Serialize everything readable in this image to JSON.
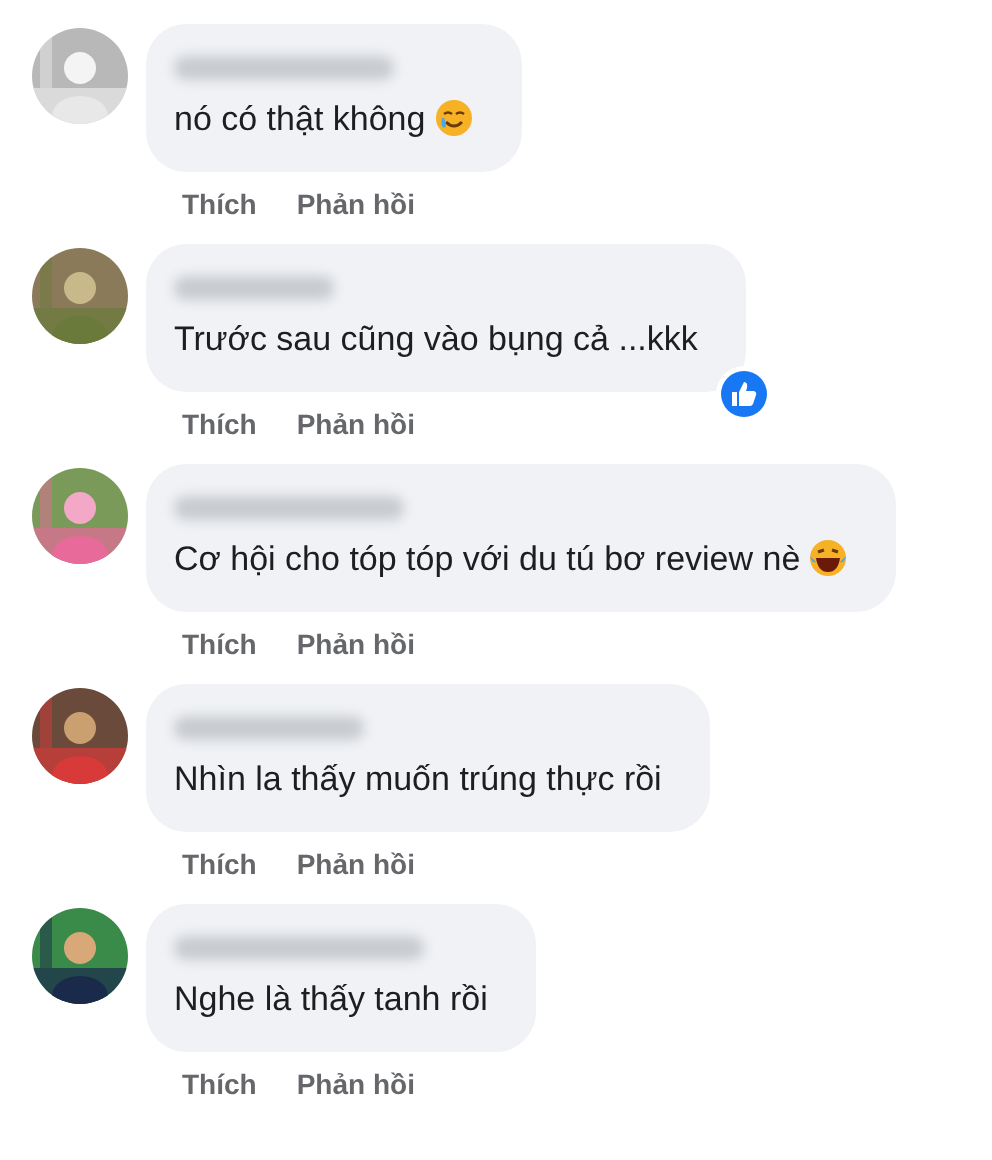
{
  "comments": [
    {
      "text": "nó có thật không",
      "emoji": {
        "kind": "tearful"
      },
      "actions": [
        "Thích",
        "Phản hồi"
      ]
    },
    {
      "text": "Trước sau cũng vào bụng cả ...kkk",
      "reaction": {
        "kind": "like"
      },
      "actions": [
        "Thích",
        "Phản hồi"
      ]
    },
    {
      "text": "Cơ hội cho tóp tóp với du tú bơ review nè",
      "emoji": {
        "kind": "laughing"
      },
      "actions": [
        "Thích",
        "Phản hồi"
      ]
    },
    {
      "text": "Nhìn la thấy muốn trúng thực rồi",
      "actions": [
        "Thích",
        "Phản hồi"
      ]
    },
    {
      "text": "Nghe là thấy tanh rồi",
      "actions": [
        "Thích",
        "Phản hồi"
      ]
    }
  ]
}
